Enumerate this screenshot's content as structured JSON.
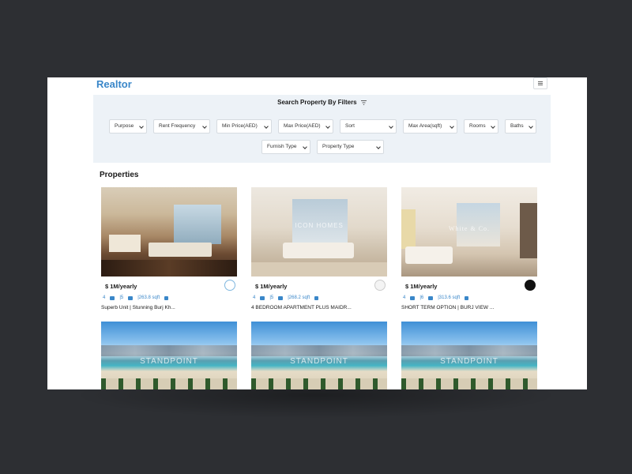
{
  "brand": "Realtor",
  "filters": {
    "title": "Search Property By Filters",
    "row1": [
      "Purpose",
      "Rent Frequency",
      "Min Price(AED)",
      "Max Price(AED)",
      "Sort",
      "Max Area(sqft)",
      "Rooms",
      "Baths"
    ],
    "row2": [
      "Furnish Type",
      "Property Type"
    ]
  },
  "section_title": "Properties",
  "cards": [
    {
      "price": "$ 1M/yearly",
      "rooms": "4",
      "baths": "|5",
      "area": "|263.8 sqft",
      "title": "Superb Unit | Stunning Burj Kh..."
    },
    {
      "price": "$ 1M/yearly",
      "rooms": "4",
      "baths": "|5",
      "area": "|268.2 sqft",
      "title": "4 BEDROOM APARTMENT PLUS MAIDR...",
      "watermark": "ICON HOMES"
    },
    {
      "price": "$ 1M/yearly",
      "rooms": "4",
      "baths": "|6",
      "area": "|313.6 sqft",
      "title": "SHORT TERM OPTION | BURJ VIEW ...",
      "watermark": "White & Co."
    }
  ],
  "bottom_cards": [
    {
      "watermark": "STANDPOINT"
    },
    {
      "watermark": "STANDPOINT"
    },
    {
      "watermark": "STANDPOINT"
    }
  ],
  "colors": {
    "accent": "#3a87c9",
    "filter_bg": "#edf2f7",
    "page_bg": "#2d2f33"
  },
  "icons": [
    "menu-icon",
    "filter-icon",
    "chevron-down-icon",
    "bed-icon",
    "bath-icon",
    "area-icon",
    "grid-icon"
  ]
}
